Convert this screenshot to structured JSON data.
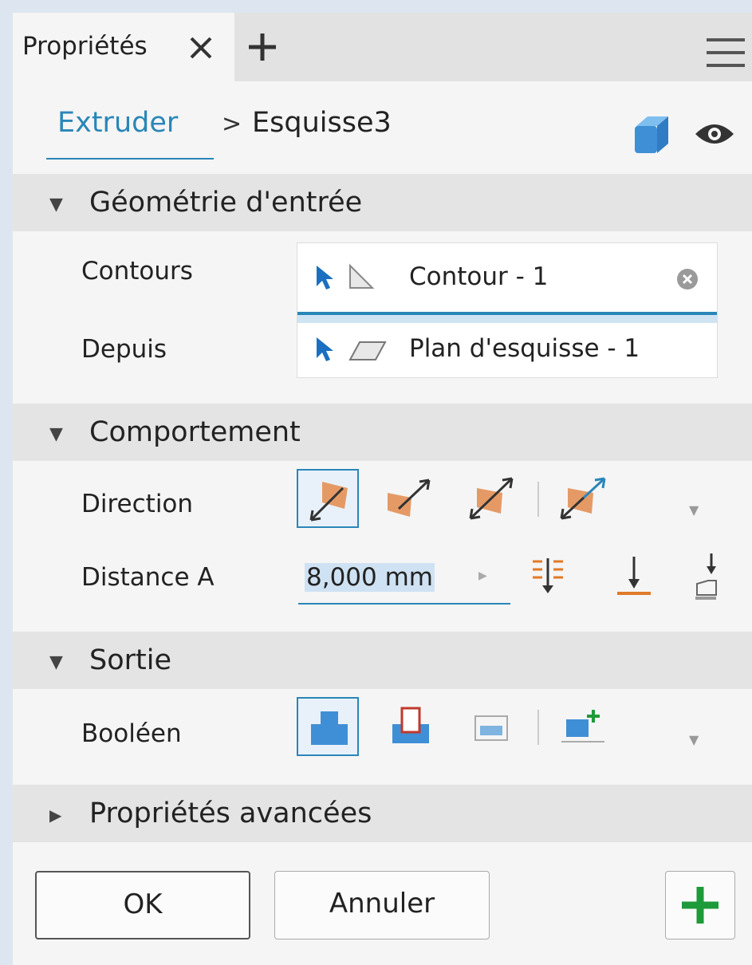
{
  "tab": {
    "label": "Propriétés"
  },
  "breadcrumb": {
    "feature": "Extruder",
    "separator": ">",
    "sketch": "Esquisse3"
  },
  "sections": {
    "input_geometry": {
      "title": "Géométrie d'entrée",
      "contours_label": "Contours",
      "contours_value": "Contour - 1",
      "from_label": "Depuis",
      "from_value": "Plan d'esquisse - 1"
    },
    "behavior": {
      "title": "Comportement",
      "direction_label": "Direction",
      "distance_label": "Distance A",
      "distance_value": "8,000 mm"
    },
    "output": {
      "title": "Sortie",
      "boolean_label": "Booléen"
    },
    "advanced": {
      "title": "Propriétés avancées"
    }
  },
  "footer": {
    "ok_label": "OK",
    "cancel_label": "Annuler"
  },
  "colors": {
    "accent": "#2a86b8",
    "face": "#e59a66",
    "solid": "#3f8fd6",
    "add": "#1f9a3a"
  },
  "icons": [
    "close-icon",
    "plus-icon",
    "menu-icon",
    "solid-body-icon",
    "eye-icon",
    "cursor-arrow-icon",
    "profile-icon",
    "plane-icon",
    "clear-icon"
  ]
}
